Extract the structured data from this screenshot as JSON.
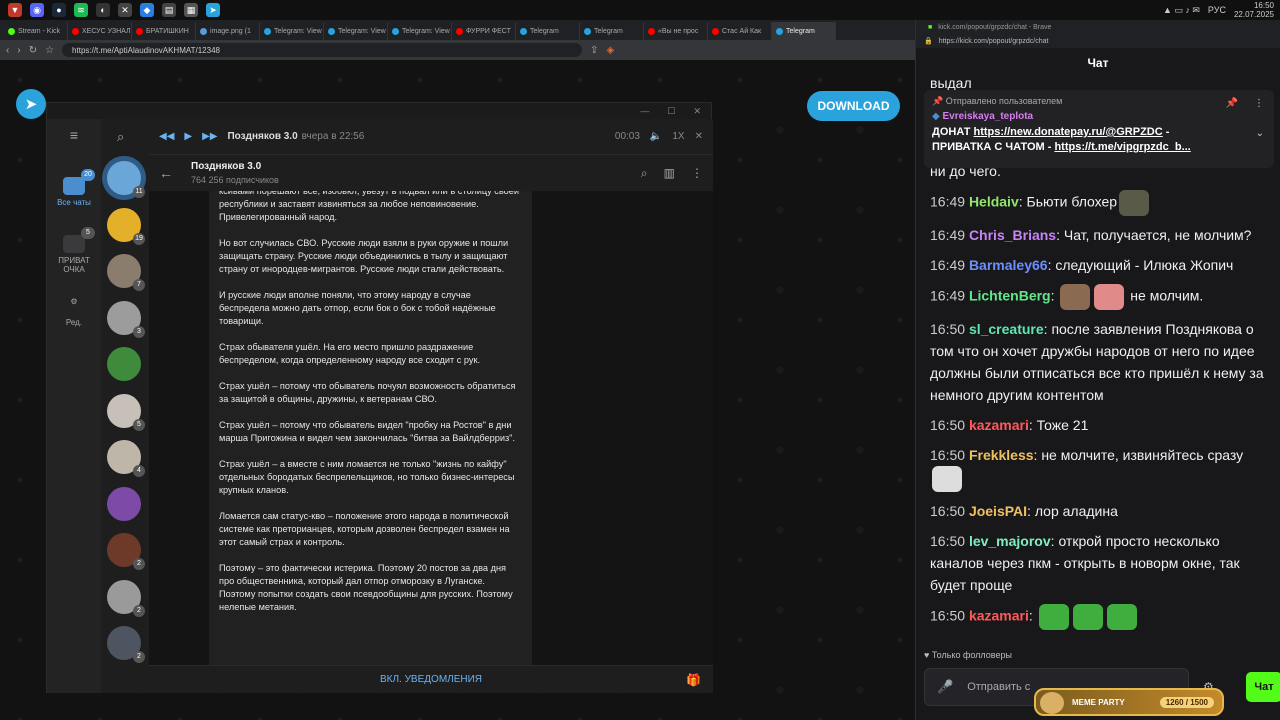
{
  "taskbar": {
    "lang": "РУС",
    "time": "16:50",
    "date": "22.07.2025"
  },
  "browser": {
    "tabs": [
      {
        "label": "Stream - Kick"
      },
      {
        "label": "ХЕСУС УЗНАЛ"
      },
      {
        "label": "БРАТИШКИН"
      },
      {
        "label": "image.png (1"
      },
      {
        "label": "Telegram: View"
      },
      {
        "label": "Telegram: View"
      },
      {
        "label": "Telegram: View"
      },
      {
        "label": "ФУРРИ ФЕСТ"
      },
      {
        "label": "Telegram"
      },
      {
        "label": "Telegram"
      },
      {
        "label": "«Вы не прос"
      },
      {
        "label": "Стас Ай Как"
      },
      {
        "label": "Telegram"
      }
    ],
    "url": "https://t.me/AptiAlaudinovAKHMAT/12348"
  },
  "telegram": {
    "download": "DOWNLOAD",
    "folders": [
      {
        "label": "Все чаты",
        "badge": "20"
      },
      {
        "label": "ПРИВАТ ОЧКА",
        "badge": "5"
      },
      {
        "label": "Ред.",
        "badge": ""
      }
    ],
    "chats": [
      {
        "count": "11",
        "color": "#6aa7d8"
      },
      {
        "count": "19",
        "color": "#e4b02a"
      },
      {
        "count": "7",
        "color": "#8a7d6e"
      },
      {
        "count": "3",
        "color": "#9c9c9c"
      },
      {
        "count": "",
        "color": "#3f8b3c"
      },
      {
        "count": "5",
        "color": "#c7c0b8"
      },
      {
        "count": "4",
        "color": "#bfb6aa"
      },
      {
        "count": "",
        "color": "#7d4aa8"
      },
      {
        "count": "2",
        "color": "#6d3a2a"
      },
      {
        "count": "2",
        "color": "#9a9a9a"
      },
      {
        "count": "2",
        "color": "#4c5560"
      }
    ],
    "player": {
      "author": "Поздняков 3.0",
      "when": "вчера в 22:56",
      "time": "00:03",
      "speed": "1X"
    },
    "channel": {
      "name": "Поздняков 3.0",
      "subscribers": "764 256 подписчиков"
    },
    "message": [
      "ксивами порешают все, изобьют, увезут в подвал или в столицу своей республики и заставят извиняться за любое неповиновение. Привелегированный народ.",
      "Но вот случилась СВО. Русские люди взяли в руки оружие и пошли защищать страну. Русские люди объединились в тылу и защищают страну от инородцев-мигрантов. Русские люди стали действовать.",
      "И русские люди вполне поняли, что этому народу в случае беспредела можно дать отпор, если бок о бок с тобой надёжные товарищи.",
      "Страх обывателя ушёл. На его место пришло раздражение беспределом, когда определенному народу все сходит с рук.",
      "Страх ушёл – потому что обыватель почуял возможность обратиться за защитой в общины, дружины, к ветеранам СВО.",
      "Страх ушёл – потому что обыватель видел \"пробку на Ростов\" в дни марша Пригожина и видел чем закончилась \"битва за Вайлдберриз\".",
      "Страх ушёл – а вместе с ним ломается не только \"жизнь по кайфу\" отдельных бородатых беспрелельщиков, но только бизнес-интересы крупных кланов.",
      "Ломается сам статус-кво – положение этого народа в политической системе как преторианцев, которым дозволен беспредел взамен на этот самый страх и контроль.",
      "Поэтому – это фактически истерика. Поэтому 20 постов за два дня про общественника, который дал отпор отморозку в Луганске. Поэтому попытки создать свои псевдообщины для русских. Поэтому нелепые метания."
    ],
    "unread_badge": "11",
    "notify_button": "ВКЛ. УВЕДОМЛЕНИЯ"
  },
  "kick": {
    "window_title": "kick.com/popout/grpzdc/chat - Brave",
    "url": "https://kick.com/popout/grpzdc/chat",
    "header": "Чат",
    "pinned": {
      "head": "Отправлено пользователем",
      "user": "Evreiskaya_teplota",
      "line1_label": "ДОНАТ ",
      "line1_link": "https://new.donatepay.ru/@GRPZDC",
      "line1_tail": " -",
      "line2_label": "ПРИВАТКА С ЧАТОМ - ",
      "line2_link": "https://t.me/vipgrpzdc_b..."
    },
    "top_fragment": "выдал",
    "overlap_fragment": "ни до чего.",
    "messages": [
      {
        "time": "16:49",
        "user": "Heldaiv",
        "color": "#8fe86a",
        "text": "Бьюти блохер",
        "emotes": 1
      },
      {
        "time": "16:49",
        "user": "Chris_Brians",
        "color": "#c784f5",
        "text": "Чат, получается, не молчим?",
        "emotes": 0
      },
      {
        "time": "16:49",
        "user": "Barmaley66",
        "color": "#6c8fff",
        "text": "следующий - Илюка Жопич",
        "emotes": 0
      },
      {
        "time": "16:49",
        "user": "LichtenBerg",
        "color": "#5ee88a",
        "text": "не молчим.",
        "emotes": 2
      },
      {
        "time": "16:50",
        "user": "sl_creature",
        "color": "#5ee8b0",
        "text": "после заявления Позднякова о том что он хочет дружбы народов от него по идее должны были отписаться все кто пришёл к нему за немного другим контентом",
        "emotes": 0
      },
      {
        "time": "16:50",
        "user": "kazamari",
        "color": "#ff5a5a",
        "text": "Тоже 21",
        "emotes": 0
      },
      {
        "time": "16:50",
        "user": "Frekkless",
        "color": "#f0c060",
        "text": "не молчите, извиняйтесь сразу",
        "emotes": 1
      },
      {
        "time": "16:50",
        "user": "JoeisPAI",
        "color": "#f0c060",
        "text": "лор аладина",
        "emotes": 0
      },
      {
        "time": "16:50",
        "user": "lev_majorov",
        "color": "#7ef0c0",
        "text": "открой просто несколько каналов через пкм - открыть в новорм окне, так будет проще",
        "emotes": 0
      },
      {
        "time": "16:50",
        "user": "kazamari",
        "color": "#ff5a5a",
        "text": "",
        "emotes": 3
      }
    ],
    "followers_only": "Только фолловеры",
    "input_placeholder": "Отправить с",
    "send": "Чат",
    "meme": {
      "label": "MEME PARTY",
      "progress": "1260 / 1500"
    }
  }
}
